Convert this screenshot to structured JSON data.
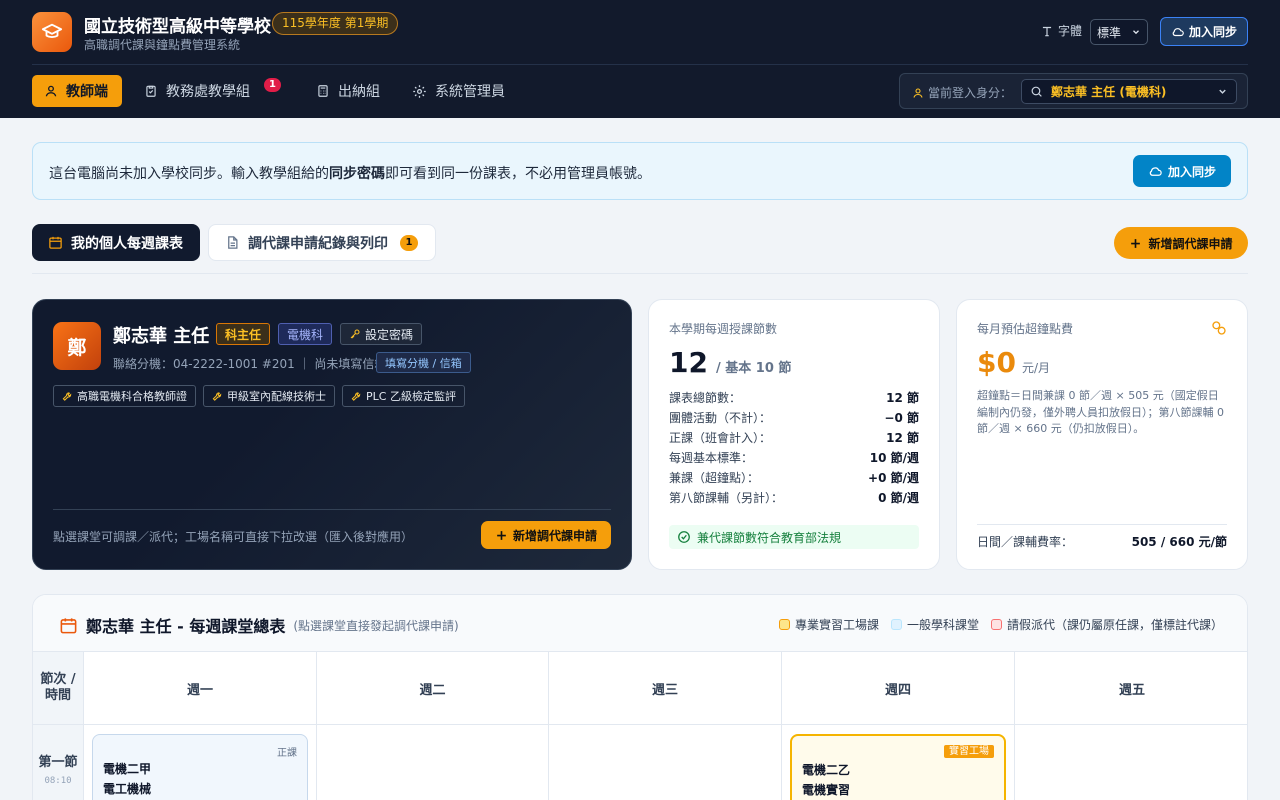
{
  "header": {
    "school_name": "國立技術型高級中等學校",
    "term": "115學年度 第1學期",
    "subtitle": "高職調代課與鐘點費管理系統",
    "font_label": "字體",
    "font_value": "標準",
    "sync_button": "加入同步"
  },
  "nav": {
    "items": [
      {
        "label": "教師端",
        "icon": "user-icon",
        "active": true
      },
      {
        "label": "教務處教學組",
        "icon": "clipboard-icon",
        "badge": "1"
      },
      {
        "label": "出納組",
        "icon": "calculator-icon"
      },
      {
        "label": "系統管理員",
        "icon": "gear-icon"
      }
    ],
    "login_label": "當前登入身分：",
    "login_value": "鄭志華 主任 (電機科)"
  },
  "banner": {
    "text_before": "這台電腦尚未加入學校同步。輸入教學組給的",
    "text_bold": "同步密碼",
    "text_after": "即可看到同一份課表，不必用管理員帳號。",
    "button": "加入同步"
  },
  "tabs": {
    "schedule": "我的個人每週課表",
    "records": "調代課申請紀錄與列印",
    "records_badge": "1",
    "add_button": "新增調代課申請"
  },
  "profile": {
    "avatar_char": "鄭",
    "name": "鄭志華 主任",
    "role_tag": "科主任",
    "dept_tag": "電機科",
    "password_button": "設定密碼",
    "contact": "聯絡分機：04-2222-1001 #201 ｜ 尚未填寫信箱",
    "fill_button": "填寫分機 / 信箱",
    "certs": [
      "高職電機科合格教師證",
      "甲級室內配線技術士",
      "PLC 乙級檢定監評"
    ],
    "hint": "點選課堂可調課／派代；工場名稱可直接下拉改選（匯入後對應用）",
    "add_button": "新增調代課申請"
  },
  "hours_card": {
    "title": "本學期每週授課節數",
    "big_value": "12",
    "big_unit": "/ 基本 10 節",
    "rows": [
      {
        "label": "課表總節數：",
        "value": "12 節"
      },
      {
        "label": "團體活動（不計）：",
        "value": "−0 節"
      },
      {
        "label": "正課（班會計入）：",
        "value": "12 節"
      },
      {
        "label": "每週基本標準：",
        "value": "10 節/週"
      },
      {
        "label": "兼課（超鐘點）：",
        "value": "+0 節/週"
      },
      {
        "label": "第八節課輔（另計）：",
        "value": "0 節/週"
      }
    ],
    "status": "兼代課節數符合教育部法規"
  },
  "fee_card": {
    "title": "每月預估超鐘點費",
    "amount": "$0",
    "unit": "元/月",
    "description": "超鐘點＝日間兼課 0 節／週 × 505 元（國定假日編制內仍發，僅外聘人員扣放假日）；第八節課輔 0 節／週 × 660 元（仍扣放假日）。",
    "rate_label": "日間／課輔費率：",
    "rate_value": "505 / 660 元/節"
  },
  "schedule": {
    "title": "鄭志華 主任 - 每週課堂總表",
    "hint": "(點選課堂直接發起調代課申請)",
    "legend": [
      {
        "label": "專業實習工場課",
        "color": "#fde68a",
        "border": "#f59e0b"
      },
      {
        "label": "一般學科課堂",
        "color": "#e0f2fe",
        "border": "#bae6fd"
      },
      {
        "label": "請假派代（課仍屬原任課，僅標註代課）",
        "color": "#fee2e2",
        "border": "#f87171"
      }
    ],
    "corner": "節次 / 時間",
    "days": [
      "週一",
      "週二",
      "週三",
      "週四",
      "週五"
    ],
    "period_label": "第一節",
    "period_time": "08:10",
    "lessons": [
      {
        "day": 0,
        "tag": "正課",
        "class": "電機二甲",
        "subject": "電工機械",
        "kind": "normal"
      },
      {
        "day": 3,
        "tag": "實習工場",
        "class": "電機二乙",
        "subject": "電機實習",
        "kind": "workshop"
      }
    ]
  },
  "colors": {
    "accent": "#f59e0b",
    "navy": "#121a2c",
    "sky": "#0284c7",
    "success": "#15803d"
  }
}
